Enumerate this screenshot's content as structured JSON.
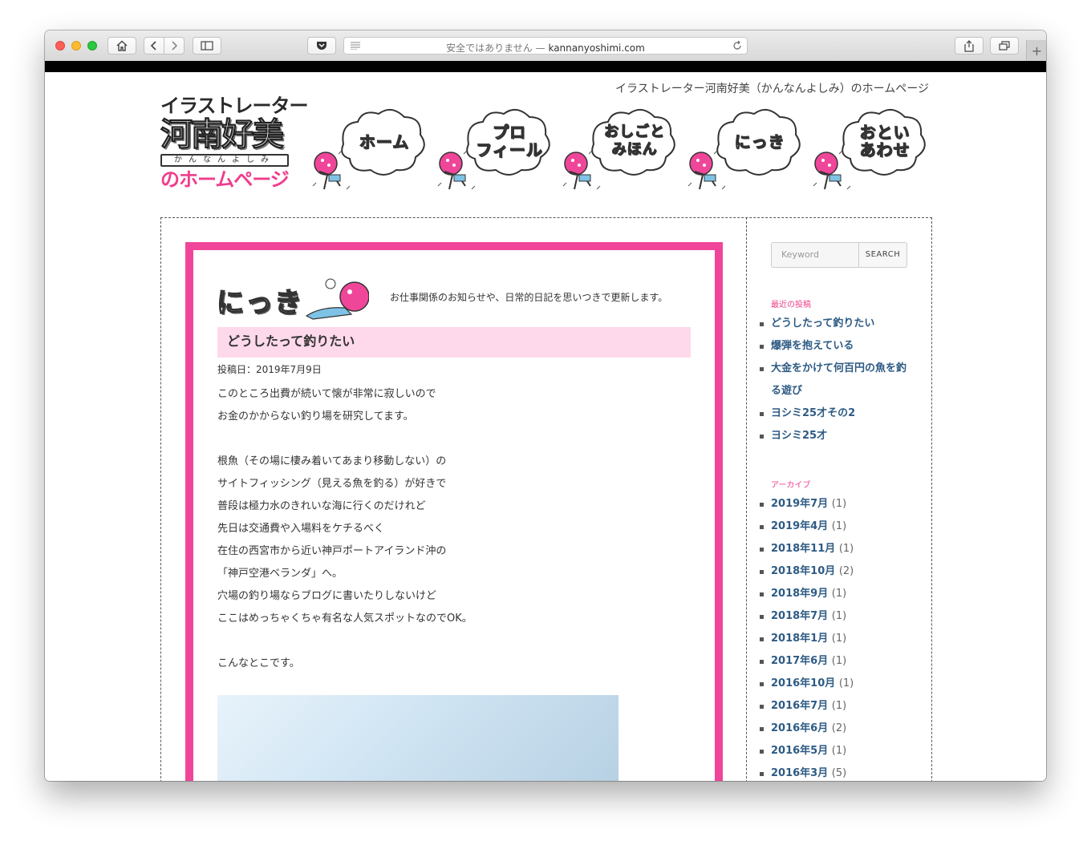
{
  "browser": {
    "address_insecure": "安全ではありません —",
    "address_domain": "kannanyoshimi.com"
  },
  "header": {
    "tagline": "イラストレーター河南好美（かんなんよしみ）のホームページ",
    "logo": {
      "line1": "イラストレーター",
      "line2": "河南好美",
      "line3": "かんなんよしみ",
      "line4": "のホームページ"
    },
    "nav": [
      {
        "label": "ホーム"
      },
      {
        "label": "プロ\nフィール"
      },
      {
        "label": "おしごと\nみほん"
      },
      {
        "label": "にっき"
      },
      {
        "label": "おとい\nあわせ"
      }
    ]
  },
  "section": {
    "title": "にっき",
    "description": "お仕事関係のお知らせや、日常的日記を思いつきで更新します。"
  },
  "post": {
    "title": "どうしたって釣りたい",
    "date": "投稿日：2019年7月9日",
    "paragraphs": [
      "このところ出費が続いて懐が非常に寂しいので",
      "お金のかからない釣り場を研究してます。",
      "",
      "根魚（その場に棲み着いてあまり移動しない）の",
      "サイトフィッシング（見える魚を釣る）が好きで",
      "普段は極力水のきれいな海に行くのだけれど",
      "先日は交通費や入場料をケチるべく",
      "在住の西宮市から近い神戸ポートアイランド沖の",
      "「神戸空港ベランダ」へ。",
      "穴場の釣り場ならブログに書いたりしないけど",
      "ここはめっちゃくちゃ有名な人気スポットなのでOK。",
      "",
      "こんなとこです。"
    ]
  },
  "sidebar": {
    "search_placeholder": "Keyword",
    "search_button": "SEARCH",
    "recent_heading": "最近の投稿",
    "recent": [
      "どうしたって釣りたい",
      "爆弾を抱えている",
      "大金をかけて何百円の魚を釣る遊び",
      "ヨシミ25才その2",
      "ヨシミ25才"
    ],
    "archive_heading": "アーカイブ",
    "archives": [
      {
        "label": "2019年7月",
        "count": "(1)"
      },
      {
        "label": "2019年4月",
        "count": "(1)"
      },
      {
        "label": "2018年11月",
        "count": "(1)"
      },
      {
        "label": "2018年10月",
        "count": "(2)"
      },
      {
        "label": "2018年9月",
        "count": "(1)"
      },
      {
        "label": "2018年7月",
        "count": "(1)"
      },
      {
        "label": "2018年1月",
        "count": "(1)"
      },
      {
        "label": "2017年6月",
        "count": "(1)"
      },
      {
        "label": "2016年10月",
        "count": "(1)"
      },
      {
        "label": "2016年7月",
        "count": "(1)"
      },
      {
        "label": "2016年6月",
        "count": "(2)"
      },
      {
        "label": "2016年5月",
        "count": "(1)"
      },
      {
        "label": "2016年3月",
        "count": "(5)"
      }
    ]
  },
  "colors": {
    "accent_pink": "#f0469a",
    "title_bg": "#fdd9eb",
    "link_blue": "#2e5b84"
  }
}
